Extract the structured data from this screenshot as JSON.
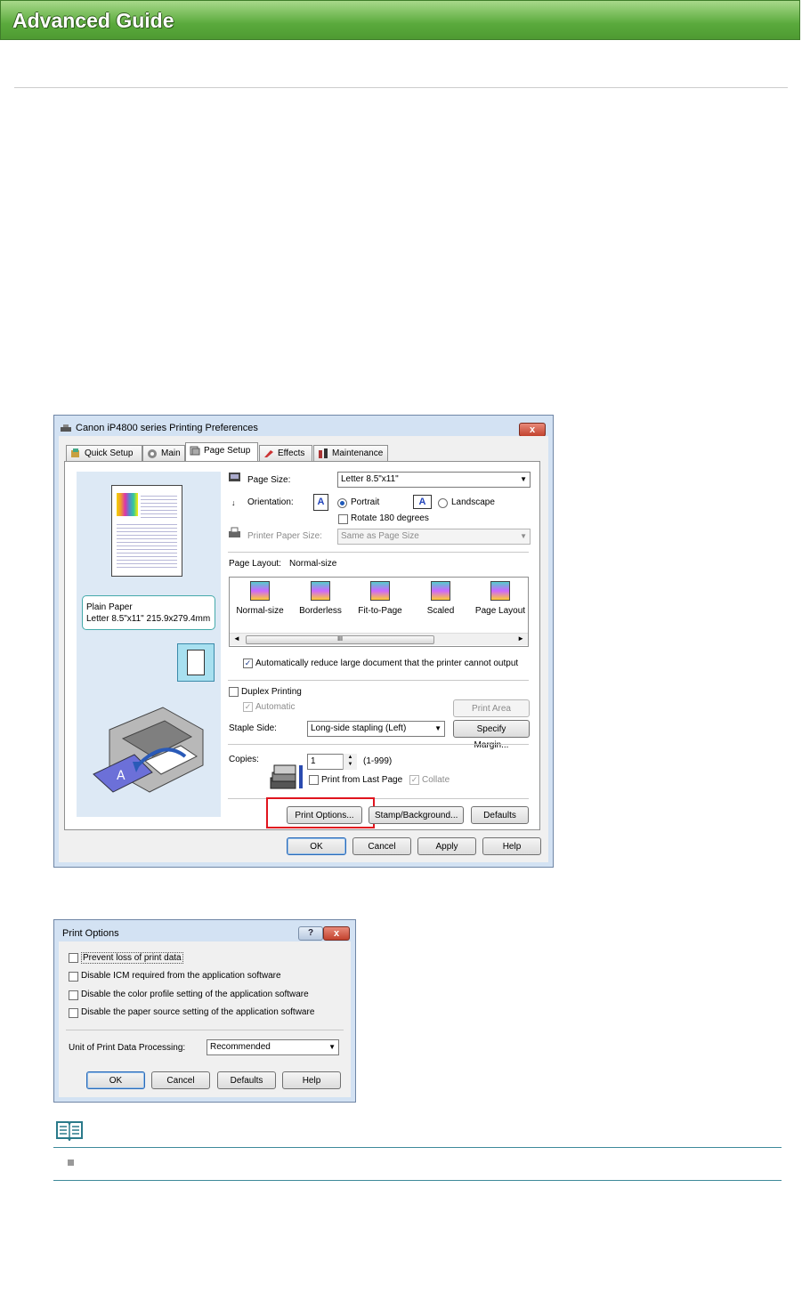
{
  "header": {
    "title": "Advanced Guide"
  },
  "prefs_window": {
    "title": "Canon iP4800 series Printing Preferences",
    "close": "x",
    "tabs": [
      {
        "label": "Quick Setup",
        "icon": "quick-setup-icon"
      },
      {
        "label": "Main",
        "icon": "main-tab-icon"
      },
      {
        "label": "Page Setup",
        "icon": "page-setup-icon",
        "active": true
      },
      {
        "label": "Effects",
        "icon": "effects-icon"
      },
      {
        "label": "Maintenance",
        "icon": "maintenance-icon"
      }
    ],
    "preview_info": {
      "line1": "Plain Paper",
      "line2": "Letter 8.5\"x11\" 215.9x279.4mm"
    },
    "page_size": {
      "label": "Page Size:",
      "value": "Letter 8.5\"x11\""
    },
    "orientation": {
      "label": "Orientation:",
      "portrait": "Portrait",
      "landscape": "Landscape",
      "rotate": "Rotate 180 degrees",
      "selected": "Portrait"
    },
    "printer_paper_size": {
      "label": "Printer Paper Size:",
      "value": "Same as Page Size"
    },
    "page_layout": {
      "label": "Page Layout:",
      "value": "Normal-size",
      "items": [
        "Normal-size",
        "Borderless",
        "Fit-to-Page",
        "Scaled",
        "Page Layout"
      ]
    },
    "scroll_thumb": "III",
    "auto_reduce": "Automatically reduce large document that the printer cannot output",
    "duplex": {
      "label": "Duplex Printing",
      "automatic": "Automatic",
      "print_area": "Print Area Setup..."
    },
    "staple": {
      "label": "Staple Side:",
      "value": "Long-side stapling (Left)",
      "specify_margin": "Specify Margin..."
    },
    "copies": {
      "label": "Copies:",
      "value": "1",
      "range": "(1-999)",
      "from_last": "Print from Last Page",
      "collate": "Collate"
    },
    "buttons": {
      "print_options": "Print Options...",
      "stamp": "Stamp/Background...",
      "defaults": "Defaults",
      "ok": "OK",
      "cancel": "Cancel",
      "apply": "Apply",
      "help": "Help"
    }
  },
  "print_options_dialog": {
    "title": "Print Options",
    "help": "?",
    "close": "x",
    "options": [
      "Prevent loss of print data",
      "Disable ICM required from the application software",
      "Disable the color profile setting of the application software",
      "Disable the paper source setting of the application software"
    ],
    "unit_label": "Unit of Print Data Processing:",
    "unit_value": "Recommended",
    "buttons": {
      "ok": "OK",
      "cancel": "Cancel",
      "defaults": "Defaults",
      "help": "Help"
    }
  },
  "colors": {
    "header_green": "#5aaa3c",
    "highlight_red": "#e0141e",
    "note_teal": "#3e8a9a"
  }
}
